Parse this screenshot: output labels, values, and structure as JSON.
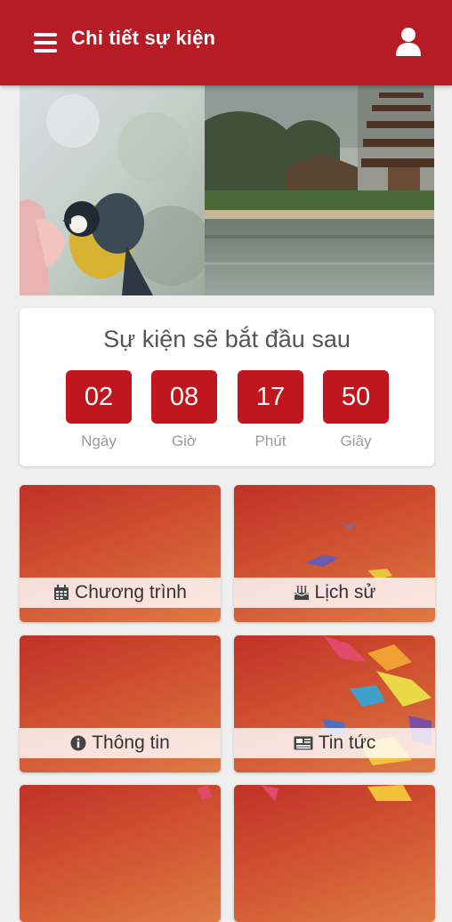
{
  "header": {
    "title": "Chi tiết sự kiện",
    "menu_icon": "menu-icon",
    "user_icon": "user-icon"
  },
  "countdown": {
    "title": "Sự kiện sẽ bắt đầu sau",
    "units": [
      {
        "value": "02",
        "label": "Ngày"
      },
      {
        "value": "08",
        "label": "Giờ"
      },
      {
        "value": "17",
        "label": "Phút"
      },
      {
        "value": "50",
        "label": "Giây"
      }
    ]
  },
  "tiles": [
    {
      "label": "Chương trình",
      "icon": "calendar-icon"
    },
    {
      "label": "Lịch sử",
      "icon": "birthday-cake-icon"
    },
    {
      "label": "Thông tin",
      "icon": "info-circle-icon"
    },
    {
      "label": "Tin tức",
      "icon": "newspaper-icon"
    }
  ],
  "colors": {
    "primary": "#b71c26",
    "countdown_box": "#c0161f",
    "tile_gradient_start": "#c03126",
    "tile_gradient_end": "#de7a45"
  }
}
